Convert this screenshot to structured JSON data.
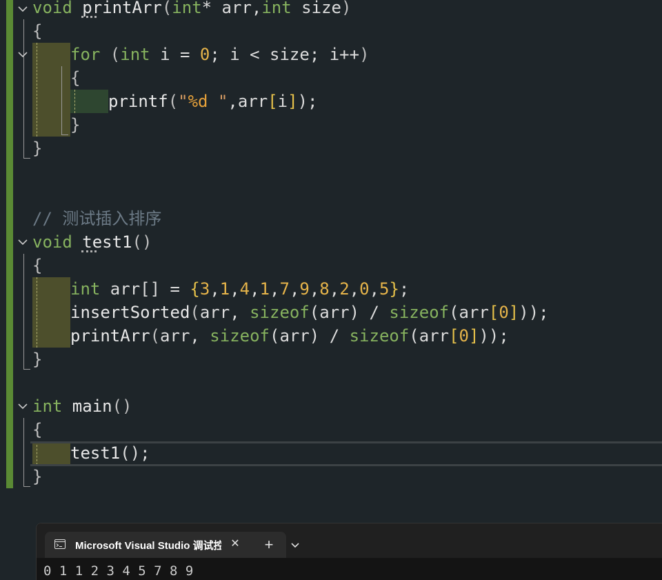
{
  "editor": {
    "lines": [
      {
        "id": "l1"
      },
      {
        "id": "l2"
      }
    ],
    "code": {
      "void1": "void",
      "printArr_name": "printArr",
      "paren_open1": "(",
      "int1": "int",
      "star": "*",
      "arr_param": " arr,",
      "int2": "int",
      "size_param": " size",
      "paren_close1": ")",
      "brace_open1": "{",
      "for_kw": "for",
      "for_open": " (",
      "int3": "int",
      "for_i": " i = ",
      "zero1": "0",
      "for_rest": "; i < size; i++",
      "for_close": ")",
      "brace_open2": "{",
      "printf_name": "printf",
      "printf_open": "(",
      "str_q1": "\"",
      "str_fmt": "%d",
      "str_q2": " \"",
      "printf_args": ",arr",
      "lb": "[",
      "idx_i": "i",
      "rb": "]",
      "printf_close": ");",
      "brace_close2": "}",
      "brace_close1": "}",
      "comment": "// 测试插入排序",
      "void2": "void",
      "test1_name": "test1",
      "test1_parens": "()",
      "brace_open3": "{",
      "int4": "int",
      "arr_decl": " arr[] = ",
      "init_open": "{",
      "init_vals": [
        "3",
        "1",
        "4",
        "1",
        "7",
        "9",
        "8",
        "2",
        "0",
        "5"
      ],
      "init_close": "}",
      "semi": ";",
      "insert_name": "insertSorted",
      "insert_open": "(",
      "insert_arr": "arr, ",
      "sizeof1": "sizeof",
      "sizeof_arr1": "(arr) / ",
      "sizeof2": "sizeof",
      "sizeof_arr2_open": "(arr",
      "lb2": "[",
      "zero2": "0",
      "rb2": "]",
      "insert_close": "));",
      "printArr_call": "printArr",
      "print_open": "(",
      "print_arr": "arr, ",
      "sizeof3": "sizeof",
      "sizeof_arr3": "(arr) / ",
      "sizeof4": "sizeof",
      "sizeof_arr4_open": "(arr",
      "lb3": "[",
      "zero3": "0",
      "rb3": "]",
      "print_close": "));",
      "brace_close3": "}",
      "int5": "int",
      "main_name": " main",
      "main_parens": "()",
      "brace_open4": "{",
      "test1_call": "test1",
      "test1_call_end": "();",
      "brace_close4": "}"
    }
  },
  "terminal": {
    "tab_title": "Microsoft Visual Studio 调试控制台",
    "close_glyph": "✕",
    "add_glyph": "+",
    "output": "0 1 1 2 3 4 5 7 8 9"
  },
  "colors": {
    "keyword": "#87b35f",
    "number": "#e6b44a",
    "comment": "#6c7a86",
    "background": "#1e2529",
    "change_bar": "#5a8a34"
  }
}
